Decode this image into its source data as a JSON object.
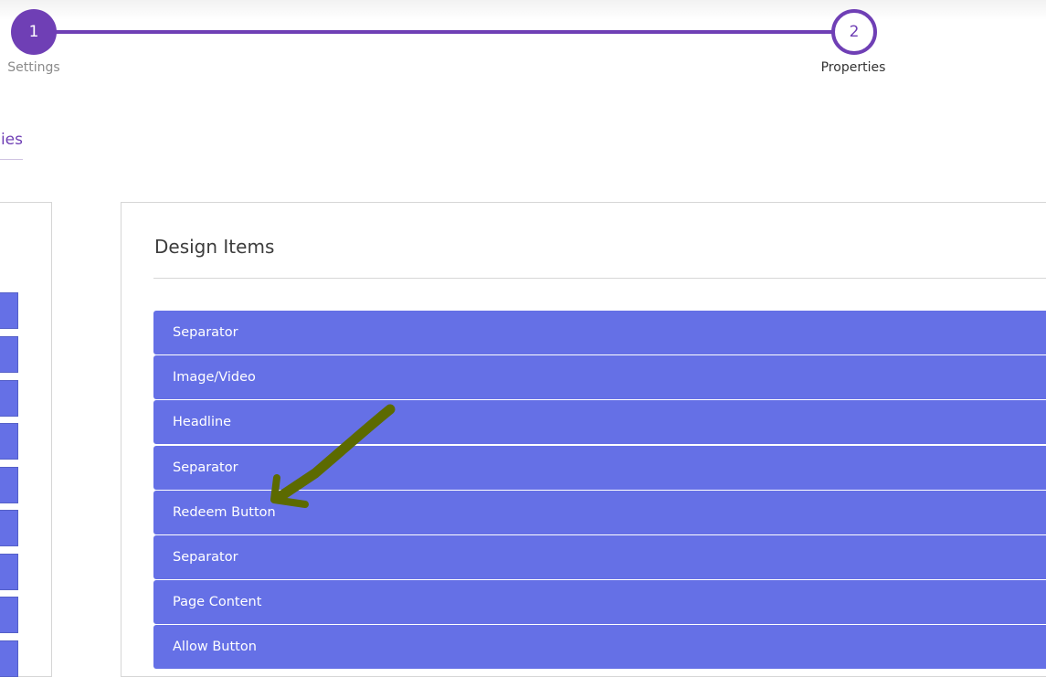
{
  "stepper": {
    "steps": [
      {
        "number": "1",
        "label": "Settings"
      },
      {
        "number": "2",
        "label": "Properties"
      }
    ]
  },
  "tabs": {
    "active_partial_label": "ies"
  },
  "design_items": {
    "title": "Design Items",
    "items": [
      {
        "label": "Separator"
      },
      {
        "label": "Image/Video"
      },
      {
        "label": "Headline"
      },
      {
        "label": "Separator"
      },
      {
        "label": "Redeem Button"
      },
      {
        "label": "Separator"
      },
      {
        "label": "Page Content"
      },
      {
        "label": "Allow Button"
      }
    ]
  },
  "colors": {
    "accent": "#6f3fb5",
    "item_background": "#6570e6",
    "annotation_arrow": "#5c6a00"
  },
  "annotation": {
    "icon": "arrow-icon",
    "points_to": "Redeem Button"
  }
}
